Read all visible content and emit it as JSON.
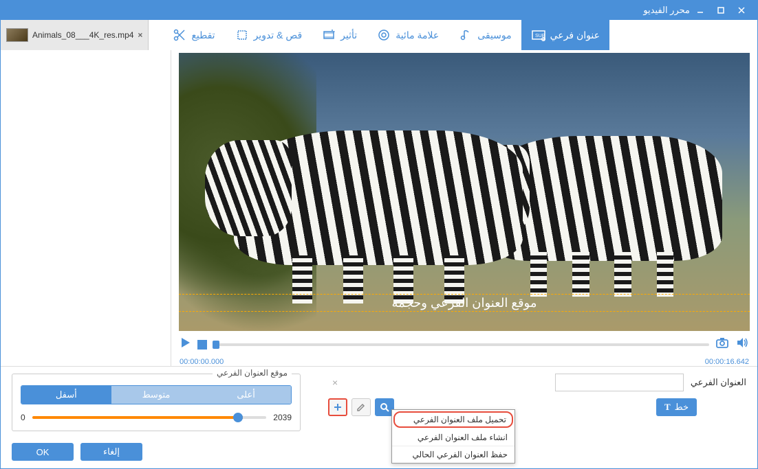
{
  "window": {
    "title": "محرر الفيديو"
  },
  "file": {
    "name": "Animals_08___4K_res.mp4"
  },
  "toolbar": {
    "trim": "تقطيع",
    "crop_rotate": "قص & تدوير",
    "effect": "تأثير",
    "watermark": "علامة مائية",
    "music": "موسيقى",
    "subtitle": "عنوان فرعي"
  },
  "preview": {
    "subtitle_guide": "موقع العنوان الفرعي وحجمه"
  },
  "playback": {
    "current": "00:00:00.000",
    "total": "00:00:16.642"
  },
  "subtitle_panel": {
    "label": "العنوان الفرعي",
    "font_btn": "خط",
    "menu": {
      "load": "تحميل ملف العنوان الفرعي",
      "create": "انشاء ملف العنوان الفرعي",
      "export": "حفظ العنوان الفرعي الحالي"
    }
  },
  "position_panel": {
    "legend": "موقع العنوان الفرعي",
    "top": "أعلى",
    "middle": "متوسط",
    "bottom": "أسفل",
    "min": "0",
    "max": "2039"
  },
  "actions": {
    "ok": "OK",
    "cancel": "إلغاء"
  }
}
